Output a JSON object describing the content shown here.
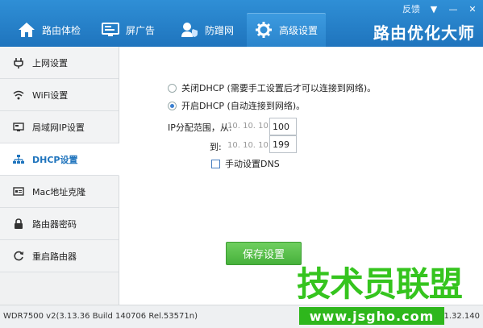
{
  "window": {
    "feedback": "反馈",
    "controls": [
      "▼",
      "—",
      "✕"
    ]
  },
  "tabs": [
    {
      "label": "路由体检",
      "icon": "home-icon",
      "active": false
    },
    {
      "label": "屏广告",
      "icon": "monitor-icon",
      "active": false
    },
    {
      "label": "防蹭网",
      "icon": "user-shield-icon",
      "active": false
    },
    {
      "label": "高级设置",
      "icon": "gear-icon",
      "active": true
    }
  ],
  "brand": "路由优化大师",
  "sidebar": {
    "items": [
      {
        "label": "上网设置",
        "icon": "plug-icon"
      },
      {
        "label": "WiFi设置",
        "icon": "wifi-icon"
      },
      {
        "label": "局域网IP设置",
        "icon": "lan-icon"
      },
      {
        "label": "DHCP设置",
        "icon": "network-tree-icon",
        "active": true
      },
      {
        "label": "Mac地址克隆",
        "icon": "card-icon"
      },
      {
        "label": "路由器密码",
        "icon": "lock-icon"
      },
      {
        "label": "重启路由器",
        "icon": "restart-icon"
      }
    ]
  },
  "dhcp": {
    "off_label": "关闭DHCP (需要手工设置后才可以连接到网络)。",
    "on_label": "开启DHCP (自动连接到网络)。",
    "selected": "on",
    "range_label_from": "IP分配范围，从:",
    "range_label_to": "到:",
    "ip_prefix": "10. 10. 10.",
    "start_value": "100",
    "end_value": "199",
    "manual_dns_label": "手动设置DNS",
    "manual_dns_checked": false,
    "save_label": "保存设置"
  },
  "status": {
    "version": "WDR7500 v2(3.13.36 Build 140706 Rel.53571n)",
    "version_right": "1.32.140"
  },
  "watermark": {
    "text": "技术员联盟",
    "url": "www.jsgho.com"
  },
  "colors": {
    "header_blue": "#1f74bd",
    "save_green": "#47b13b",
    "watermark_green": "#35c41e"
  }
}
